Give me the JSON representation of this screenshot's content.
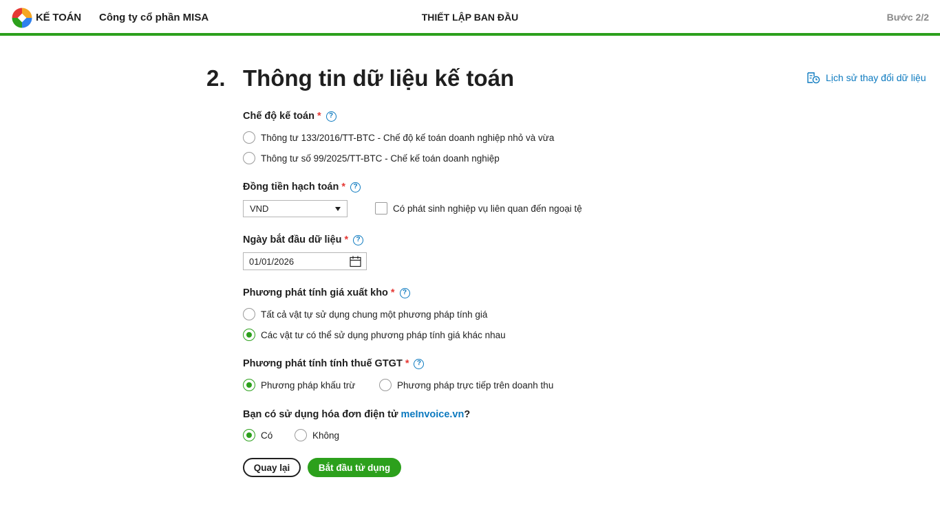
{
  "header": {
    "app_name": "KẾ TOÁN",
    "company": "Công ty cổ phần MISA",
    "title": "THIẾT LẬP BAN ĐẦU",
    "step": "Bước 2/2"
  },
  "page": {
    "number": "2.",
    "title": "Thông tin dữ liệu kế toán",
    "history_link": "Lịch sử thay đổi dữ liệu"
  },
  "accounting_regime": {
    "label": "Chế độ kế toán",
    "required_mark": "*",
    "help": "?",
    "options": [
      {
        "label": "Thông tư 133/2016/TT-BTC - Chế độ kế toán doanh nghiệp nhỏ và vừa",
        "checked": false
      },
      {
        "label": "Thông tư số 99/2025/TT-BTC - Chế kế toán doanh nghiệp",
        "checked": false
      }
    ]
  },
  "currency": {
    "label": "Đồng tiền hạch toán",
    "required_mark": "*",
    "help": "?",
    "selected": "VND",
    "foreign_checkbox_label": "Có phát sinh nghiệp vụ liên quan đến ngoại tệ",
    "foreign_checked": false
  },
  "start_date": {
    "label": "Ngày bắt đầu dữ liệu",
    "required_mark": "*",
    "help": "?",
    "value": "01/01/2026"
  },
  "inventory_method": {
    "label": "Phương phát tính giá xuất kho",
    "required_mark": "*",
    "help": "?",
    "options": [
      {
        "label": "Tất cả vật tự sử dụng chung một phương pháp tính giá",
        "checked": false
      },
      {
        "label": "Các vật tư có thể sử dụng phương pháp tính giá khác nhau",
        "checked": true
      }
    ]
  },
  "vat_method": {
    "label": "Phương phát tính tính thuế GTGT",
    "required_mark": "*",
    "help": "?",
    "options": [
      {
        "label": "Phương pháp khấu trừ",
        "checked": true
      },
      {
        "label": "Phương pháp trực tiếp trên doanh thu",
        "checked": false
      }
    ]
  },
  "einvoice": {
    "question_prefix": "Bạn có sử dụng hóa đơn điện tử ",
    "link": "meInvoice.vn",
    "question_suffix": "?",
    "options": [
      {
        "label": "Có",
        "checked": true
      },
      {
        "label": "Không",
        "checked": false
      }
    ]
  },
  "buttons": {
    "back": "Quay lại",
    "start": "Bắt đầu tử dụng"
  },
  "colors": {
    "accent_green": "#2ca01c",
    "link_blue": "#0b79bf",
    "required_red": "#e53935"
  }
}
